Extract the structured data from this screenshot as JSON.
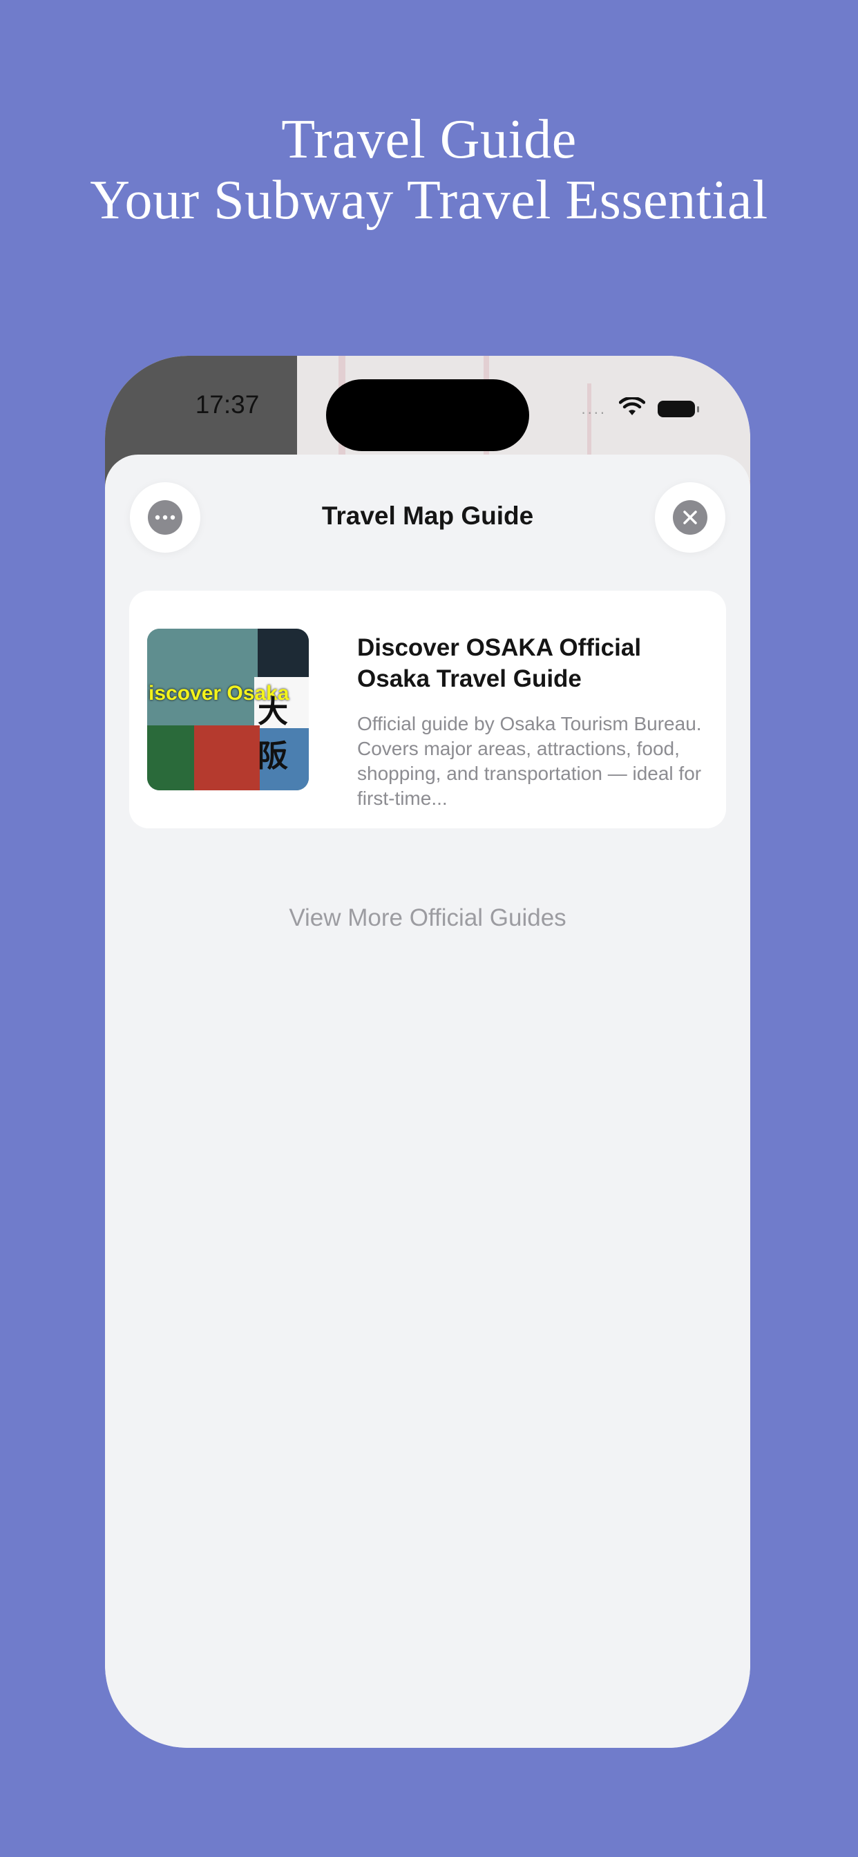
{
  "headline": {
    "line1": "Travel Guide",
    "line2": "Your Subway Travel Essential"
  },
  "status_bar": {
    "time": "17:37",
    "signal_dots": "....",
    "wifi_icon": "wifi-icon",
    "battery_icon": "battery-icon"
  },
  "sheet": {
    "title": "Travel Map Guide",
    "more_icon": "ellipsis-icon",
    "close_icon": "close-icon"
  },
  "guide_card": {
    "title": "Discover OSAKA Official Osaka Travel Guide",
    "description": "Official guide by Osaka Tourism Bureau. Covers major areas, attractions, food, shopping, and transportation — ideal for first-time...",
    "thumbnail_text": "iscover Osaka",
    "thumbnail_kanji": "大阪"
  },
  "view_more_label": "View More Official Guides",
  "colors": {
    "background": "#707ccb",
    "sheet": "#f2f3f5",
    "card": "#ffffff",
    "muted_text": "#9c9ca1"
  }
}
